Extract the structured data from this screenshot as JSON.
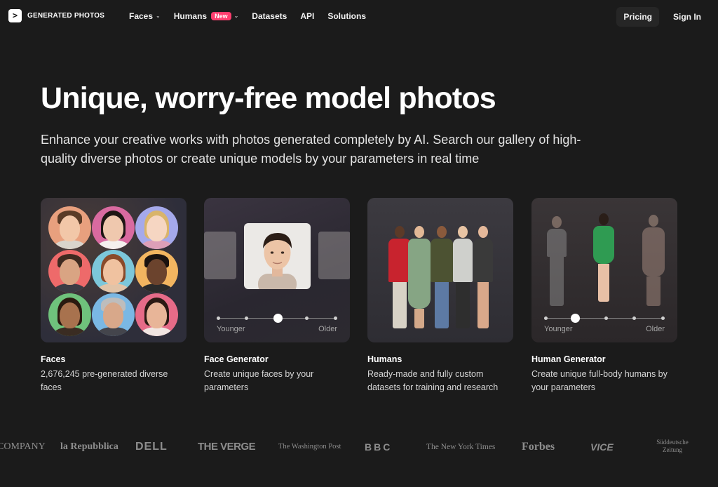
{
  "brand": {
    "name": "GENERATED PHOTOS",
    "mark": ">"
  },
  "nav": {
    "items": [
      {
        "label": "Faces",
        "has_dropdown": true
      },
      {
        "label": "Humans",
        "badge": "New",
        "has_dropdown": true
      },
      {
        "label": "Datasets"
      },
      {
        "label": "API"
      },
      {
        "label": "Solutions"
      }
    ],
    "pricing": "Pricing",
    "signin": "Sign In"
  },
  "hero": {
    "title": "Unique, worry-free model photos",
    "subtitle": "Enhance your creative works with photos generated completely by AI. Search our gallery of high-quality diverse photos or create unique models by your parameters in real time"
  },
  "cards": [
    {
      "title": "Faces",
      "desc": "2,676,245 pre-generated diverse faces"
    },
    {
      "title": "Face Generator",
      "desc": "Create unique faces by your parameters",
      "slider": {
        "left": "Younger",
        "right": "Older"
      }
    },
    {
      "title": "Humans",
      "desc": "Ready-made and fully custom datasets for training and research"
    },
    {
      "title": "Human Generator",
      "desc": "Create unique full-body humans by your parameters",
      "slider": {
        "left": "Younger",
        "right": "Older"
      }
    }
  ],
  "press_logos": [
    "COMPANY",
    "la Repubblica",
    "DELL",
    "THE VERGE",
    "The Washington Post",
    "BBC",
    "The New York Times",
    "Forbes",
    "VICE",
    "Süddeutsche Zeitung"
  ],
  "colors": {
    "background": "#1b1b1b",
    "badge": "#ff3d6e",
    "logo_gray": "#8d8d8d"
  }
}
